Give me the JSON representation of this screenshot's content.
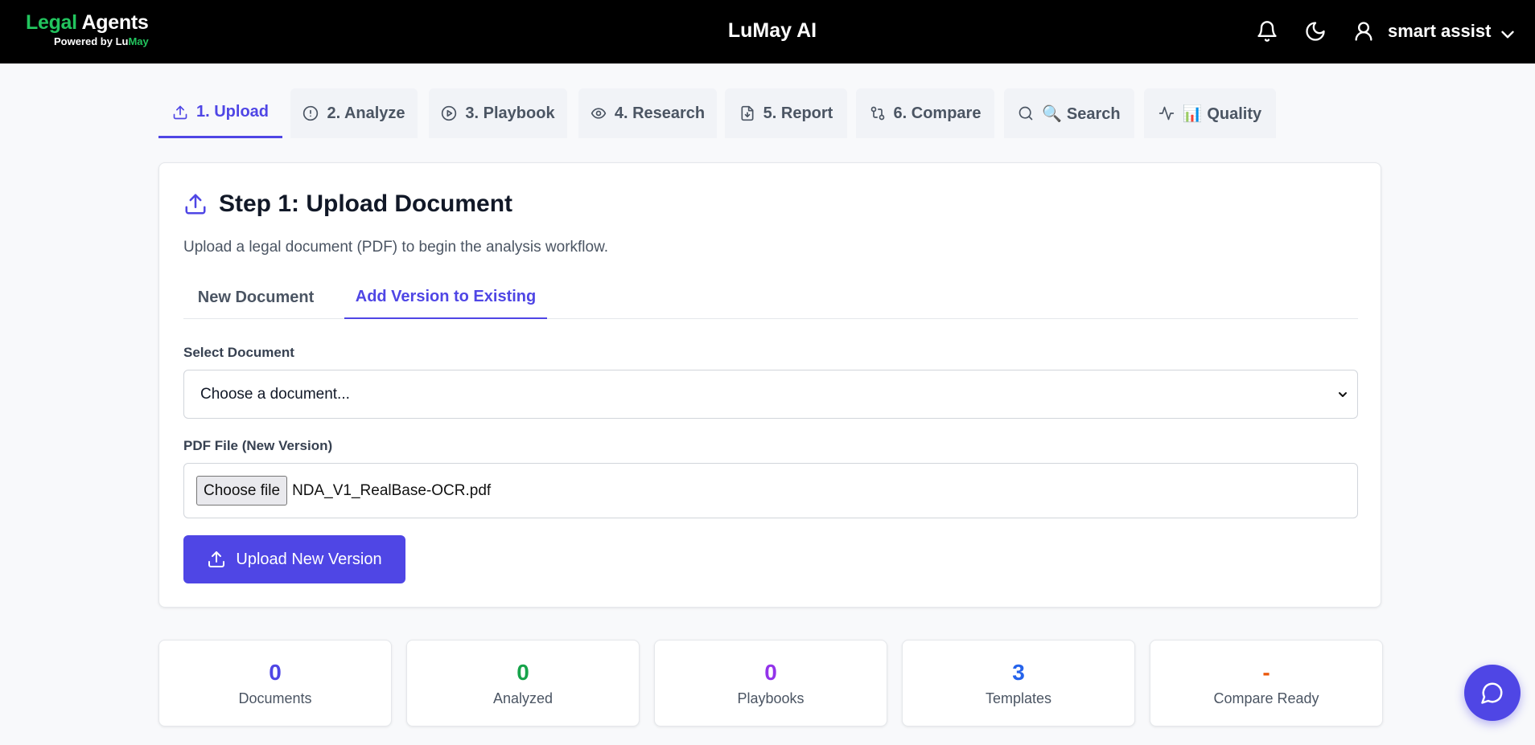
{
  "header": {
    "brand_word1": "Legal",
    "brand_word2": "Agents",
    "powered_prefix": "Powered by ",
    "powered_lu": "Lu",
    "powered_may": "May",
    "app_title": "LuMay AI",
    "username": "smart assist",
    "icons": [
      "bell-icon",
      "moon-icon",
      "user-icon",
      "chevron-down-icon"
    ]
  },
  "tabs": [
    {
      "label": "1. Upload",
      "icon": "upload-icon",
      "active": true
    },
    {
      "label": "2. Analyze",
      "icon": "alert-circle-icon",
      "active": false
    },
    {
      "label": "3. Playbook",
      "icon": "play-circle-icon",
      "active": false
    },
    {
      "label": "4. Research",
      "icon": "eye-icon",
      "active": false
    },
    {
      "label": "5. Report",
      "icon": "file-download-icon",
      "active": false
    },
    {
      "label": "6. Compare",
      "icon": "git-compare-icon",
      "active": false
    },
    {
      "label": "🔍 Search",
      "icon": "search-icon",
      "active": false
    },
    {
      "label": "📊 Quality",
      "icon": "activity-icon",
      "active": false
    }
  ],
  "card": {
    "title": "Step 1: Upload Document",
    "description": "Upload a legal document (PDF) to begin the analysis workflow.",
    "subtabs": [
      {
        "label": "New Document",
        "active": false
      },
      {
        "label": "Add Version to Existing",
        "active": true
      }
    ],
    "select_label": "Select Document",
    "select_value": "Choose a document...",
    "file_label": "PDF File (New Version)",
    "file_button": "Choose file",
    "file_name": "NDA_V1_RealBase-OCR.pdf",
    "upload_button": "Upload New Version"
  },
  "stats": [
    {
      "value": "0",
      "label": "Documents",
      "color": "#4f46e5"
    },
    {
      "value": "0",
      "label": "Analyzed",
      "color": "#16a34a"
    },
    {
      "value": "0",
      "label": "Playbooks",
      "color": "#9333ea"
    },
    {
      "value": "3",
      "label": "Templates",
      "color": "#2563eb"
    },
    {
      "value": "-",
      "label": "Compare Ready",
      "color": "#ea580c"
    }
  ],
  "accent": "#4f46e5"
}
